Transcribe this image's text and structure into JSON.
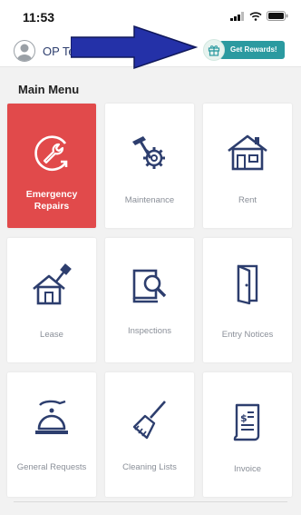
{
  "status_bar": {
    "time": "11:53"
  },
  "header": {
    "username": "OP Test Tenant",
    "rewards_label": "Get Rewards!"
  },
  "menu": {
    "title": "Main Menu",
    "tiles": [
      {
        "label": "Emergency Repairs",
        "icon": "wrench-icon"
      },
      {
        "label": "Maintenance",
        "icon": "hammer-gear-icon"
      },
      {
        "label": "Rent",
        "icon": "house-icon"
      },
      {
        "label": "Lease",
        "icon": "house-key-icon"
      },
      {
        "label": "Inspections",
        "icon": "book-magnifier-icon"
      },
      {
        "label": "Entry Notices",
        "icon": "door-icon"
      },
      {
        "label": "General Requests",
        "icon": "service-bell-icon"
      },
      {
        "label": "Cleaning Lists",
        "icon": "broom-icon"
      },
      {
        "label": "Invoice",
        "icon": "invoice-icon"
      }
    ]
  },
  "colors": {
    "accent_red": "#e14a4b",
    "icon_navy": "#2d3e6e",
    "rewards_teal": "#2b9aa0",
    "arrow_blue": "#2431a8"
  }
}
